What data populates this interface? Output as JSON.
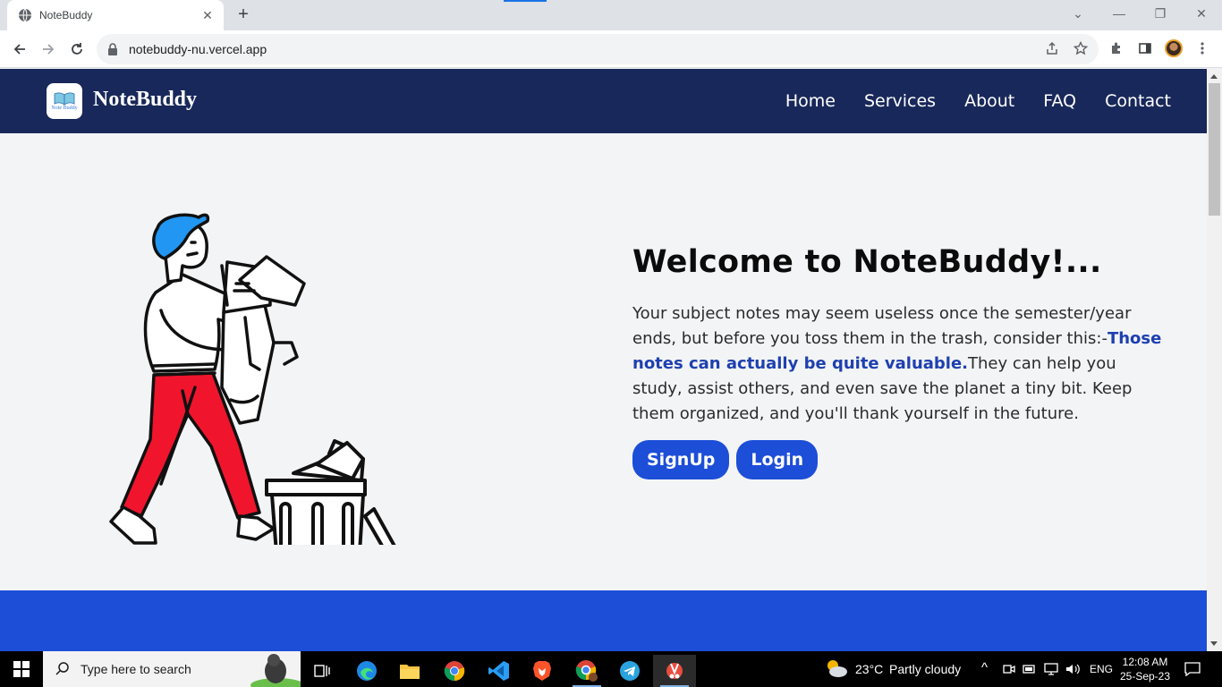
{
  "browser": {
    "tab_title": "NoteBuddy",
    "tab_close": "✕",
    "new_tab": "+",
    "url": "notebuddy-nu.vercel.app",
    "window": {
      "minimize": "—",
      "restore": "❐",
      "close": "✕",
      "tab_search": "⌄"
    }
  },
  "site": {
    "brand": "NoteBuddy",
    "logo_text": "Note Buddy",
    "nav": [
      "Home",
      "Services",
      "About",
      "FAQ",
      "Contact"
    ]
  },
  "hero": {
    "title": "Welcome to NoteBuddy!...",
    "para_part1": "Your subject notes may seem useless once the semester/year ends, but before you toss them in the trash, consider this:-",
    "para_highlight": "Those notes can actually be quite valuable.",
    "para_part2": "They can help you study, assist others, and even save the planet a tiny bit. Keep them organized, and you'll thank yourself in the future.",
    "signup_label": "SignUp",
    "login_label": "Login"
  },
  "taskbar": {
    "search_placeholder": "Type here to search",
    "weather_temp": "23°C",
    "weather_desc": "Partly cloudy",
    "language": "ENG",
    "time": "12:08 AM",
    "date": "25-Sep-23"
  },
  "colors": {
    "nav_bg": "#19285a",
    "accent": "#1d4ed8",
    "highlight_text": "#1e40af",
    "trouser_red": "#f0152c",
    "hair_blue": "#2196f3"
  }
}
